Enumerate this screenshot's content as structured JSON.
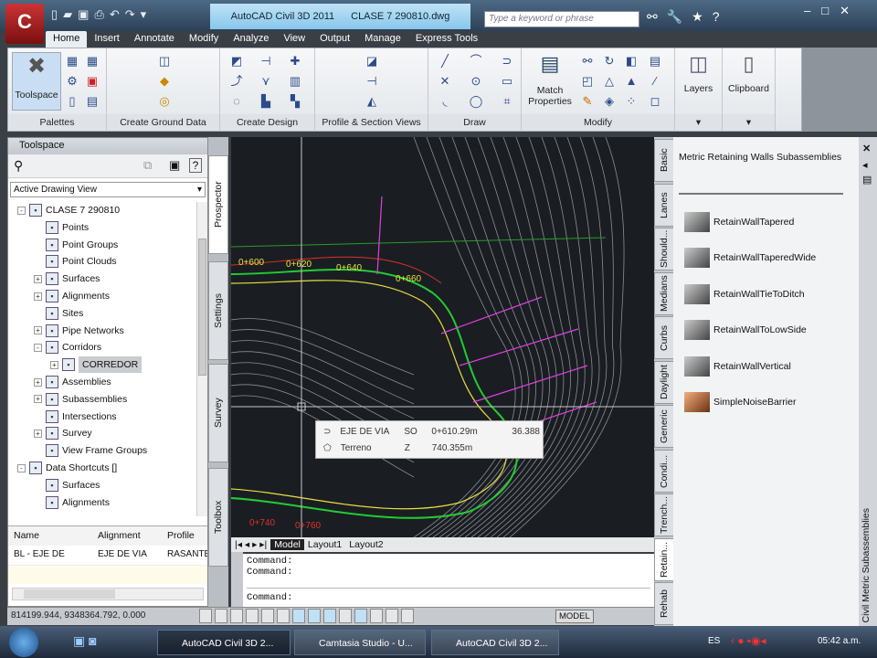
{
  "app": {
    "title": "AutoCAD Civil 3D 2011",
    "document": "CLASE 7 290810.dwg",
    "search_placeholder": "Type a keyword or phrase",
    "app_button": "C"
  },
  "tabs": [
    "Home",
    "Insert",
    "Annotate",
    "Modify",
    "Analyze",
    "View",
    "Output",
    "Manage",
    "Express Tools"
  ],
  "ribbon": {
    "panels": [
      "Palettes",
      "Create Ground Data",
      "Create Design",
      "Profile & Section Views",
      "Draw",
      "Modify",
      "",
      ""
    ],
    "toolspace_btn": "Toolspace",
    "match_properties": "Match Properties",
    "layers": "Layers",
    "clipboard": "Clipboard"
  },
  "toolspace": {
    "title": "Toolspace",
    "view": "Active Drawing View",
    "tree": [
      {
        "label": "CLASE 7 290810",
        "level": 0,
        "exp": "-"
      },
      {
        "label": "Points",
        "level": 1,
        "exp": ""
      },
      {
        "label": "Point Groups",
        "level": 1,
        "exp": ""
      },
      {
        "label": "Point Clouds",
        "level": 1,
        "exp": ""
      },
      {
        "label": "Surfaces",
        "level": 1,
        "exp": "+"
      },
      {
        "label": "Alignments",
        "level": 1,
        "exp": "+"
      },
      {
        "label": "Sites",
        "level": 1,
        "exp": ""
      },
      {
        "label": "Pipe Networks",
        "level": 1,
        "exp": "+"
      },
      {
        "label": "Corridors",
        "level": 1,
        "exp": "-"
      },
      {
        "label": "CORREDOR",
        "level": 2,
        "exp": "+",
        "selected": true
      },
      {
        "label": "Assemblies",
        "level": 1,
        "exp": "+"
      },
      {
        "label": "Subassemblies",
        "level": 1,
        "exp": "+"
      },
      {
        "label": "Intersections",
        "level": 1,
        "exp": ""
      },
      {
        "label": "Survey",
        "level": 1,
        "exp": "+"
      },
      {
        "label": "View Frame Groups",
        "level": 1,
        "exp": ""
      },
      {
        "label": "Data Shortcuts []",
        "level": 0,
        "exp": "-"
      },
      {
        "label": "Surfaces",
        "level": 1,
        "exp": ""
      },
      {
        "label": "Alignments",
        "level": 1,
        "exp": ""
      }
    ],
    "table": {
      "headers": [
        "Name",
        "Alignment",
        "Profile"
      ],
      "rows": [
        [
          "BL - EJE DE",
          "EJE DE VIA",
          "RASANTE"
        ]
      ]
    },
    "side_tabs": [
      "Prospector",
      "Settings",
      "Survey",
      "Toolbox"
    ]
  },
  "drawing": {
    "labels": [
      "0+600",
      "0+620",
      "0+640",
      "0+660",
      "0+740",
      "0+760"
    ],
    "tooltip": {
      "row1": [
        "EJE DE VIA",
        "SO",
        "0+610.29m",
        "36.388"
      ],
      "row2": [
        "Terreno",
        "Z",
        "740.355m"
      ]
    }
  },
  "layout_tabs": [
    "Model",
    "Layout1",
    "Layout2"
  ],
  "command_lines": [
    "Command:",
    "Command:",
    "",
    "Command:"
  ],
  "status": {
    "coords": "814199.944, 9348364.792, 0.000",
    "model": "MODEL"
  },
  "palette": {
    "title": "Metric Retaining Walls Subassemblies",
    "side_title": "Civil Metric Subassemblies",
    "items": [
      "RetainWallTapered",
      "RetainWallTaperedWide",
      "RetainWallTieToDitch",
      "RetainWallToLowSide",
      "RetainWallVertical",
      "SimpleNoiseBarrier"
    ],
    "tabs": [
      "Basic",
      "Lanes",
      "Should...",
      "Medians",
      "Curbs",
      "Daylight",
      "Generic",
      "Condi...",
      "Trench...",
      "Retain...",
      "Rehab"
    ]
  },
  "taskbar": {
    "items": [
      "AutoCAD Civil 3D 2...",
      "Camtasia Studio - U...",
      "AutoCAD Civil 3D 2..."
    ],
    "lang": "ES",
    "clock": "05:42 a.m."
  },
  "colors": {
    "drawing_bg": "#1a1e22",
    "alignment": "#22cc33",
    "labels": "#e040e0",
    "ribbon_bg": "#eef0f3"
  }
}
